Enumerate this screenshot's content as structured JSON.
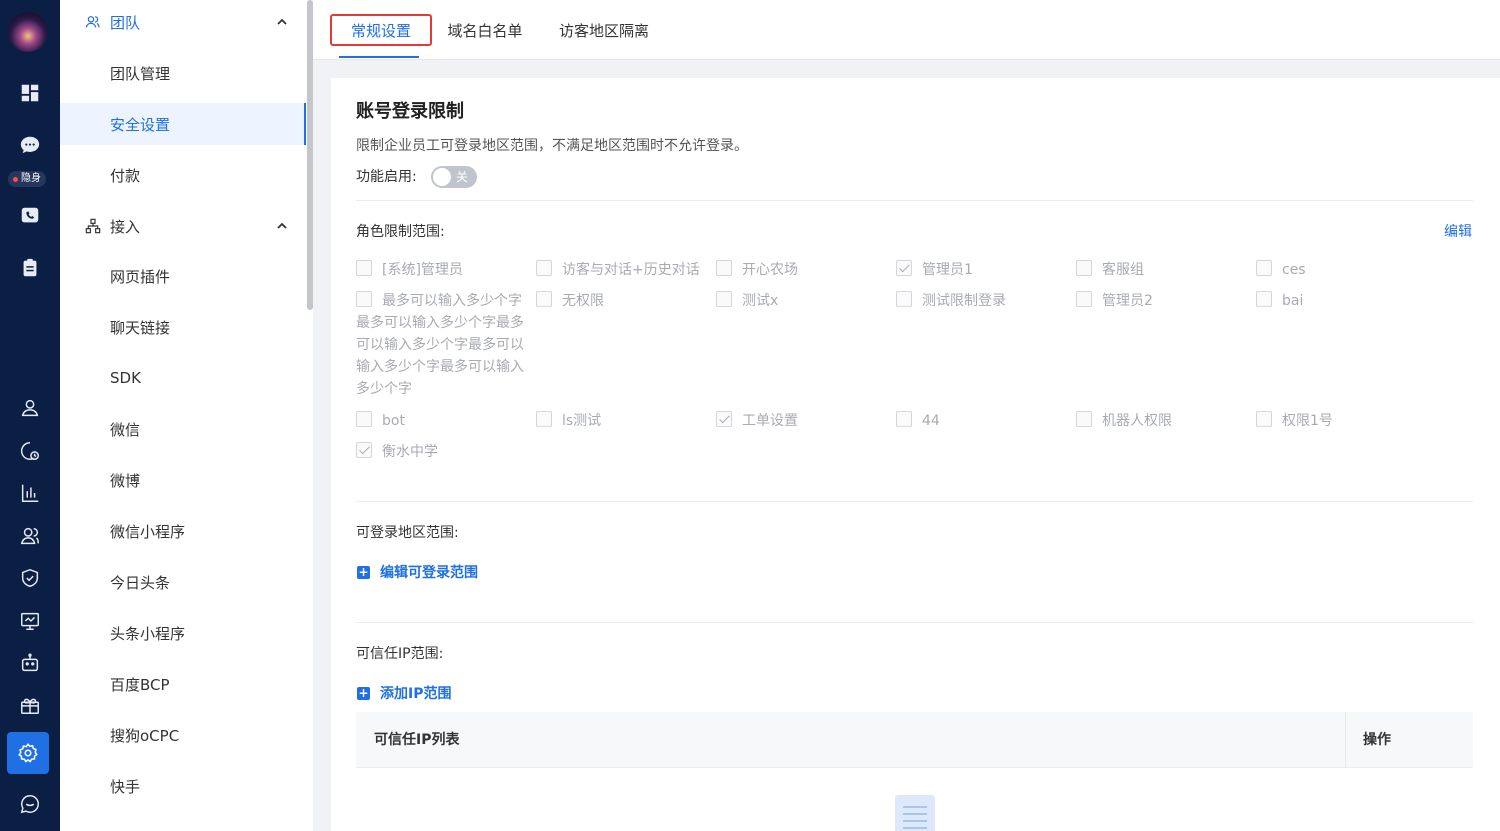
{
  "rail": {
    "badge": "隐身"
  },
  "sidebar": {
    "groups": [
      {
        "label": "团队"
      },
      {
        "label": "接入"
      }
    ],
    "team_items": [
      "团队管理",
      "安全设置",
      "付款"
    ],
    "access_items": [
      "网页插件",
      "聊天链接",
      "SDK",
      "微信",
      "微博",
      "微信小程序",
      "今日头条",
      "头条小程序",
      "百度BCP",
      "搜狗oCPC",
      "快手"
    ]
  },
  "tabs": [
    "常规设置",
    "域名白名单",
    "访客地区隔离"
  ],
  "section": {
    "title": "账号登录限制",
    "description": "限制企业员工可登录地区范围，不满足地区范围时不允许登录。",
    "enable_label": "功能启用:",
    "toggle_text": "关",
    "roles_label": "角色限制范围:",
    "edit_link": "编辑",
    "roles": [
      {
        "label": "[系统]管理员",
        "checked": false
      },
      {
        "label": "访客与对话+历史对话",
        "checked": false
      },
      {
        "label": "开心农场",
        "checked": false
      },
      {
        "label": "管理员1",
        "checked": true
      },
      {
        "label": "客服组",
        "checked": false
      },
      {
        "label": "ces",
        "checked": false
      },
      {
        "label": "最多可以输入多少个字",
        "wrapped": "最多可以输入多少个字最多可以输入多少个字最多可以输入多少个字最多可以输入多少个字",
        "checked": false
      },
      {
        "label": "无权限",
        "checked": false
      },
      {
        "label": "测试x",
        "checked": false
      },
      {
        "label": "测试限制登录",
        "checked": false
      },
      {
        "label": "管理员2",
        "checked": false
      },
      {
        "label": "bai",
        "checked": false
      },
      {
        "label": "bot",
        "checked": false
      },
      {
        "label": "ls测试",
        "checked": false
      },
      {
        "label": "工单设置",
        "checked": true
      },
      {
        "label": "44",
        "checked": false
      },
      {
        "label": "机器人权限",
        "checked": false
      },
      {
        "label": "权限1号",
        "checked": false
      },
      {
        "label": "衡水中学",
        "checked": true
      }
    ],
    "region_label": "可登录地区范围:",
    "region_link": "编辑可登录范围",
    "ip_label": "可信任IP范围:",
    "ip_link": "添加IP范围",
    "table_headers": [
      "可信任IP列表",
      "操作"
    ]
  }
}
